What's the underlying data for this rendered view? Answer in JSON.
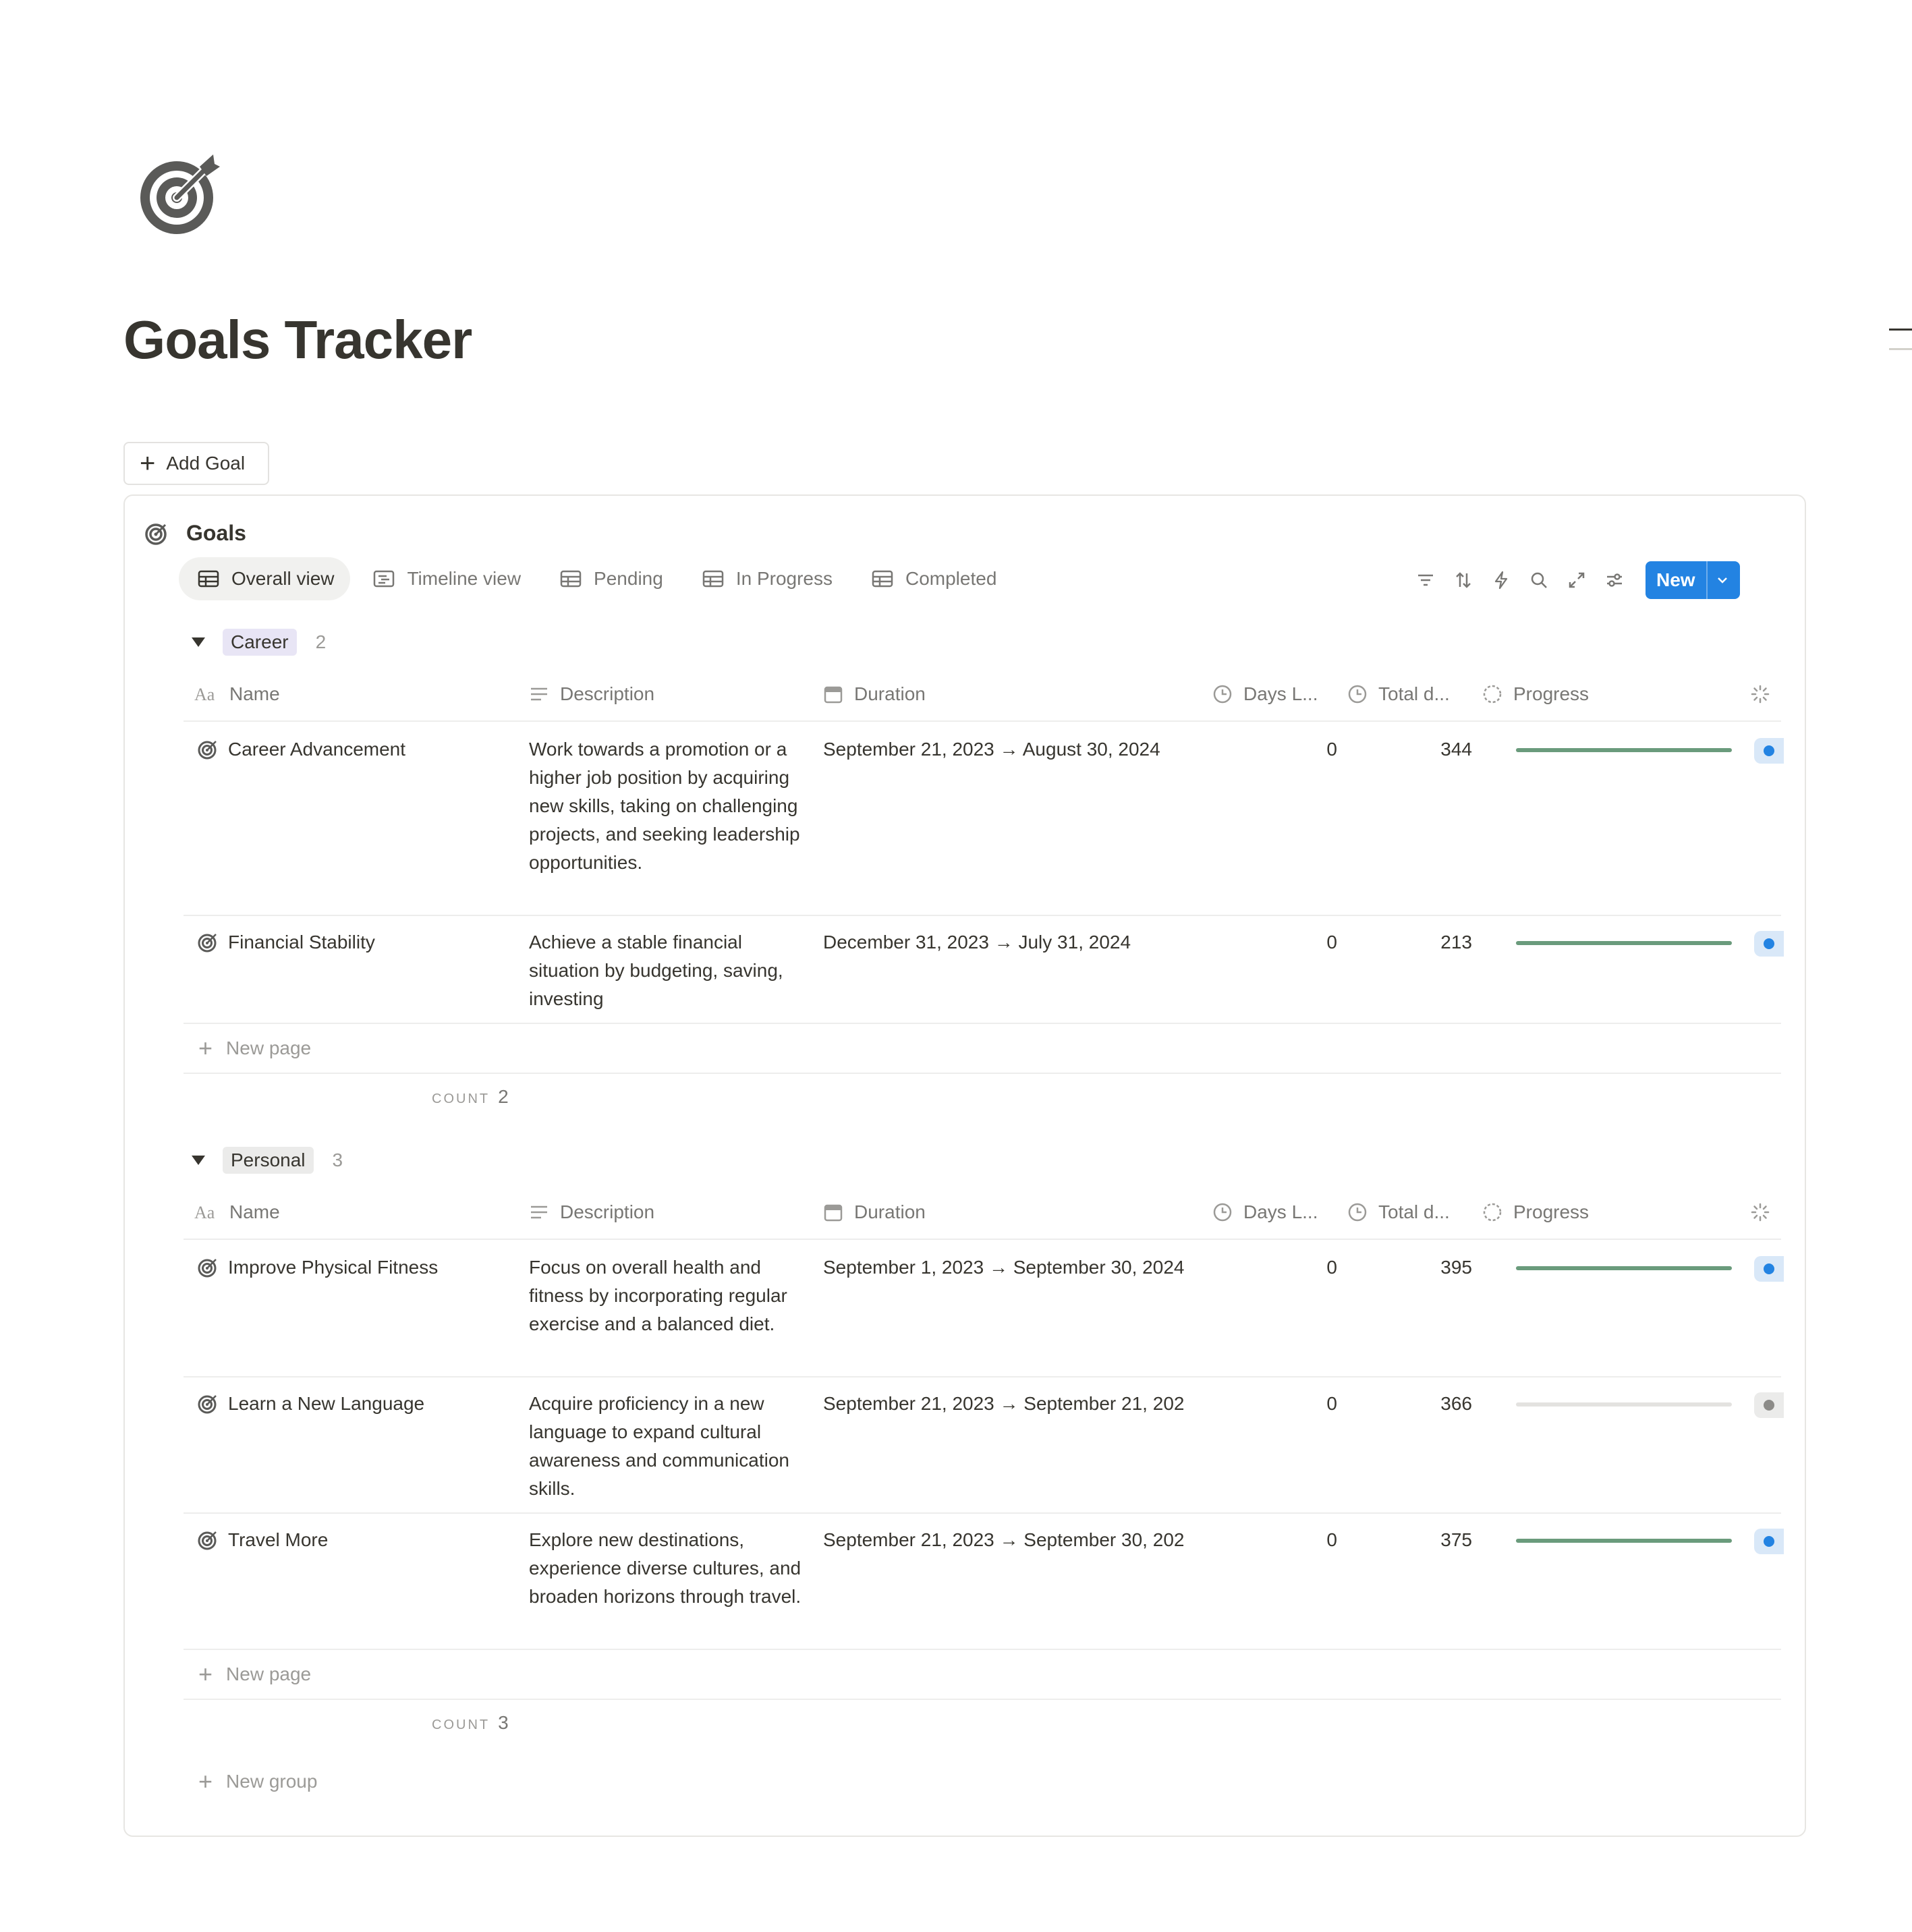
{
  "page": {
    "title": "Goals Tracker",
    "add_goal_label": "Add Goal"
  },
  "database": {
    "title": "Goals",
    "tabs": [
      {
        "label": "Overall view",
        "icon": "table-icon",
        "active": true
      },
      {
        "label": "Timeline view",
        "icon": "timeline-icon",
        "active": false
      },
      {
        "label": "Pending",
        "icon": "table-icon",
        "active": false
      },
      {
        "label": "In Progress",
        "icon": "table-icon",
        "active": false
      },
      {
        "label": "Completed",
        "icon": "table-icon",
        "active": false
      }
    ],
    "toolbar": {
      "icons": [
        "filter-icon",
        "sort-icon",
        "automation-icon",
        "search-icon",
        "expand-icon",
        "settings-icon"
      ],
      "new_label": "New"
    },
    "columns": {
      "name": "Name",
      "description": "Description",
      "duration": "Duration",
      "days_left": "Days L...",
      "total_days": "Total d...",
      "progress": "Progress"
    },
    "new_page_label": "New page",
    "count_label": "COUNT",
    "new_group_label": "New group",
    "groups": [
      {
        "label": "Career",
        "count": "2",
        "chip_color": "#e8e5f5",
        "count_value": "2",
        "rows": [
          {
            "name": "Career Advancement",
            "description": "Work towards a promotion or a higher job position by acquiring new skills, taking on challenging projects, and seeking leadership opportunities.",
            "duration": "September 21, 2023 → August 30, 2024",
            "days_left": "0",
            "total_days": "344",
            "progress": 1.0,
            "status_color": "#2383e2"
          },
          {
            "name": "Financial Stability",
            "description": "Achieve a stable financial situation by budgeting, saving, investing",
            "duration": "December 31, 2023 → July 31, 2024",
            "days_left": "0",
            "total_days": "213",
            "progress": 1.0,
            "status_color": "#2383e2"
          }
        ]
      },
      {
        "label": "Personal",
        "count": "3",
        "chip_color": "#ebebea",
        "count_value": "3",
        "rows": [
          {
            "name": "Improve Physical Fitness",
            "description": "Focus on overall health and fitness by incorporating regular exercise and a balanced diet.",
            "duration": "September 1, 2023 → September 30, 2024",
            "days_left": "0",
            "total_days": "395",
            "progress": 1.0,
            "status_color": "#2383e2"
          },
          {
            "name": "Learn a New Language",
            "description": "Acquire proficiency in a new language to expand cultural awareness and communication skills.",
            "duration": "September 21, 2023 → September 21, 202",
            "days_left": "0",
            "total_days": "366",
            "progress": 0.0,
            "status_color": "#8c8b88"
          },
          {
            "name": "Travel More",
            "description": "Explore new destinations, experience diverse cultures, and broaden horizons through travel.",
            "duration": "September 21, 2023 → September 30, 202",
            "days_left": "0",
            "total_days": "375",
            "progress": 1.0,
            "status_color": "#2383e2"
          }
        ]
      }
    ]
  }
}
